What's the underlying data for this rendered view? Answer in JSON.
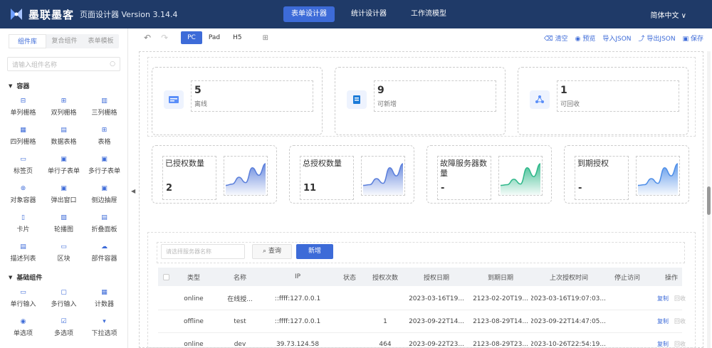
{
  "header": {
    "brand": "墨联墨客",
    "version": "页面设计器 Version 3.14.4",
    "nav": [
      {
        "label": "表单设计器",
        "active": true
      },
      {
        "label": "统计设计器",
        "active": false
      },
      {
        "label": "工作流模型",
        "active": false
      }
    ],
    "language": "简体中文 ∨"
  },
  "sidebar": {
    "tabs": [
      {
        "label": "组件库",
        "active": true
      },
      {
        "label": "复合组件",
        "active": false
      },
      {
        "label": "表单模板",
        "active": false
      }
    ],
    "search_placeholder": "请输入组件名称",
    "sections": [
      {
        "title": "容器",
        "items": [
          {
            "label": "单列栅格",
            "icon": "single-column-icon"
          },
          {
            "label": "双列栅格",
            "icon": "double-column-icon"
          },
          {
            "label": "三列栅格",
            "icon": "triple-column-icon"
          },
          {
            "label": "四列栅格",
            "icon": "quad-column-icon"
          },
          {
            "label": "数据表格",
            "icon": "data-table-icon"
          },
          {
            "label": "表格",
            "icon": "table-icon"
          },
          {
            "label": "标签页",
            "icon": "tabs-icon"
          },
          {
            "label": "单行子表单",
            "icon": "single-subform-icon"
          },
          {
            "label": "多行子表单",
            "icon": "multi-subform-icon"
          },
          {
            "label": "对象容器",
            "icon": "object-container-icon"
          },
          {
            "label": "弹出窗口",
            "icon": "popup-window-icon"
          },
          {
            "label": "侧边抽屉",
            "icon": "side-drawer-icon"
          },
          {
            "label": "卡片",
            "icon": "card-icon"
          },
          {
            "label": "轮播图",
            "icon": "carousel-icon"
          },
          {
            "label": "折叠面板",
            "icon": "collapse-panel-icon"
          },
          {
            "label": "描述列表",
            "icon": "description-list-icon"
          },
          {
            "label": "区块",
            "icon": "block-icon"
          },
          {
            "label": "部件容器",
            "icon": "widget-container-icon"
          }
        ]
      },
      {
        "title": "基础组件",
        "items": [
          {
            "label": "单行输入",
            "icon": "single-input-icon"
          },
          {
            "label": "多行输入",
            "icon": "multi-input-icon"
          },
          {
            "label": "计数器",
            "icon": "counter-icon"
          },
          {
            "label": "单选项",
            "icon": "radio-icon"
          },
          {
            "label": "多选项",
            "icon": "checkbox-icon"
          },
          {
            "label": "下拉选项",
            "icon": "select-icon"
          }
        ]
      }
    ]
  },
  "toolbar": {
    "devices": [
      {
        "label": "PC",
        "active": true
      },
      {
        "label": "Pad",
        "active": false
      },
      {
        "label": "H5",
        "active": false
      }
    ],
    "actions": [
      "清空",
      "预览",
      "导入JSON",
      "导出JSON",
      "保存"
    ]
  },
  "stats_top": [
    {
      "value": "5",
      "label": "离线",
      "icon": "server-icon",
      "color": "#5b8ff9"
    },
    {
      "value": "9",
      "label": "可新增",
      "icon": "book-icon",
      "color": "#1c7bd8"
    },
    {
      "value": "1",
      "label": "可回收",
      "icon": "recycle-icon",
      "color": "#5b8ff9"
    }
  ],
  "stats_cards": [
    {
      "title": "已授权数量",
      "value": "2",
      "color": "#5b7fdb",
      "chart_data": {
        "type": "area",
        "values": [
          1,
          1.2,
          2.2,
          1.4,
          3.6,
          2.5,
          4.2
        ]
      }
    },
    {
      "title": "总授权数量",
      "value": "11",
      "color": "#5b7fdb",
      "chart_data": {
        "type": "area",
        "values": [
          1,
          1.1,
          2.0,
          1.3,
          3.6,
          2.4,
          4.2
        ]
      }
    },
    {
      "title": "故障服务器数量",
      "value": "-",
      "color": "#2fb88a",
      "chart_data": {
        "type": "area",
        "values": [
          1,
          1.1,
          1.9,
          1.2,
          3.6,
          2.3,
          4.2
        ]
      }
    },
    {
      "title": "到期授权",
      "value": "-",
      "color": "#4f8fe8",
      "chart_data": {
        "type": "area",
        "values": [
          1,
          1.1,
          2.0,
          1.3,
          3.6,
          2.4,
          4.2
        ]
      }
    }
  ],
  "query": {
    "placeholder": "请选择服务器名称",
    "search_label": "查询",
    "add_label": "新增"
  },
  "table": {
    "columns": [
      "类型",
      "名称",
      "IP",
      "状态",
      "授权次数",
      "授权日期",
      "到期日期",
      "上次授权时间",
      "停止访问",
      "操作"
    ],
    "rows": [
      [
        "online",
        "在线授...",
        "::ffff:127.0.0.1",
        "",
        "",
        "2023-03-16T19...",
        "2123-02-20T19...",
        "2023-03-16T19:07:03....",
        "",
        ""
      ],
      [
        "offline",
        "test",
        "::ffff:127.0.0.1",
        "",
        "1",
        "2023-09-22T14...",
        "2123-08-29T14...",
        "2023-09-22T14:47:05....",
        "",
        ""
      ],
      [
        "online",
        "dev",
        "39.73.124.58",
        "",
        "464",
        "2023-09-22T23...",
        "2123-08-29T23...",
        "2023-10-26T22:54:19....",
        "",
        ""
      ]
    ],
    "op_copy": "复制",
    "op_recycle": "回收"
  }
}
